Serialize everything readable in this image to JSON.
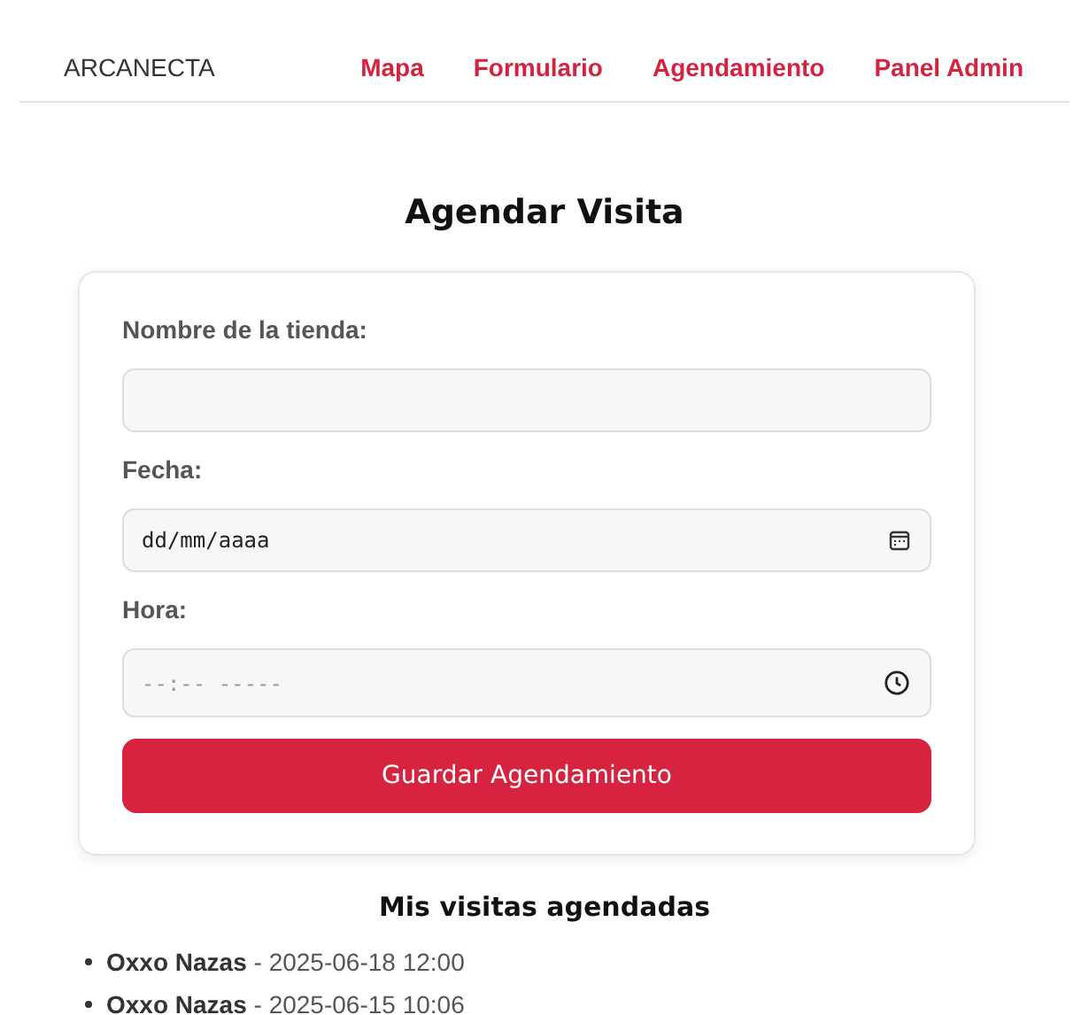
{
  "brand": "ARCANECTA",
  "nav": [
    "Mapa",
    "Formulario",
    "Agendamiento",
    "Panel Admin"
  ],
  "title": "Agendar Visita",
  "fields": [
    {
      "label": "Nombre de la tienda:",
      "kind": "text"
    },
    {
      "label": "Fecha:",
      "kind": "date",
      "placeholder": "dd/mm/aaaa"
    },
    {
      "label": "Hora:",
      "kind": "time",
      "placeholder": "--:-- -----"
    }
  ],
  "submit": "Guardar Agendamiento",
  "visits_title": "Mis visitas agendadas",
  "visits": [
    "**Oxxo Nazas** - 2025-06-18 12:00",
    "**Oxxo Nazas** - 2025-06-15 10:06"
  ]
}
